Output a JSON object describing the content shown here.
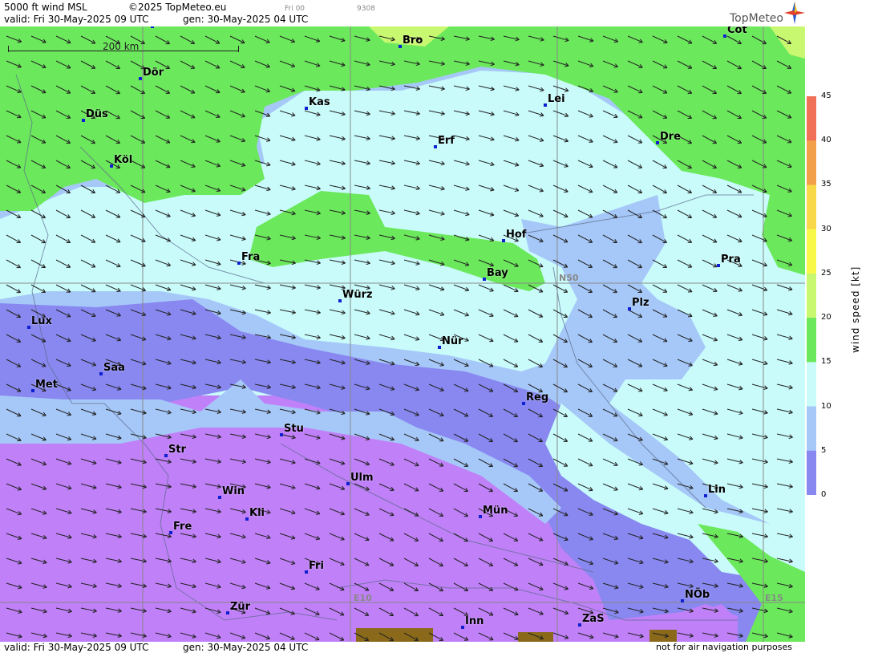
{
  "header": {
    "title": "5000 ft wind MSL",
    "copyright": "©2025 TopMeteo.eu",
    "run_small": "Fri 00",
    "code_small": "9308",
    "valid": "valid:  Fri  30-May-2025  09 UTC",
    "gen": "gen: 30-May-2025 04 UTC",
    "logo": "TopMeteo"
  },
  "footer": {
    "valid": "valid:  Fri  30-May-2025  09 UTC",
    "gen": "gen: 30-May-2025 04 UTC",
    "disclaimer": "not for air navigation purposes"
  },
  "scale_bar": {
    "label": "200 km"
  },
  "grid_labels": {
    "lat": "N50",
    "lon1": "E10",
    "lon2": "E15"
  },
  "legend": {
    "title": "wind speed [kt]",
    "ticks": [
      "45",
      "40",
      "35",
      "30",
      "25",
      "20",
      "15",
      "10",
      "5",
      "0"
    ],
    "colors": [
      "#f07058",
      "#f3a04a",
      "#f8d848",
      "#f8f848",
      "#c8f870",
      "#6ce85c",
      "#c9fbfb",
      "#a6c8f8",
      "#8888f0",
      "#c080f8"
    ]
  },
  "cities": [
    {
      "name": "Mün",
      "id": "mun-top"
    },
    {
      "name": "Bro",
      "id": "bro"
    },
    {
      "name": "Cot",
      "id": "cot"
    },
    {
      "name": "Dör",
      "id": "dor"
    },
    {
      "name": "Kas",
      "id": "kas"
    },
    {
      "name": "Lei",
      "id": "lei"
    },
    {
      "name": "Düs",
      "id": "dus"
    },
    {
      "name": "Erf",
      "id": "erf"
    },
    {
      "name": "Dre",
      "id": "dre"
    },
    {
      "name": "Köl",
      "id": "kol"
    },
    {
      "name": "Hof",
      "id": "hof"
    },
    {
      "name": "Fra",
      "id": "fra"
    },
    {
      "name": "Pra",
      "id": "pra"
    },
    {
      "name": "Bay",
      "id": "bay"
    },
    {
      "name": "Würz",
      "id": "wur"
    },
    {
      "name": "Plz",
      "id": "plz"
    },
    {
      "name": "Lux",
      "id": "lux"
    },
    {
      "name": "Nür",
      "id": "nur"
    },
    {
      "name": "Saa",
      "id": "saa"
    },
    {
      "name": "Met",
      "id": "met"
    },
    {
      "name": "Reg",
      "id": "reg"
    },
    {
      "name": "Stu",
      "id": "stu"
    },
    {
      "name": "Str",
      "id": "str"
    },
    {
      "name": "Ulm",
      "id": "ulm"
    },
    {
      "name": "Win",
      "id": "win"
    },
    {
      "name": "Lin",
      "id": "lin"
    },
    {
      "name": "Kli",
      "id": "kli"
    },
    {
      "name": "Mün",
      "id": "mun"
    },
    {
      "name": "Fre",
      "id": "fre"
    },
    {
      "name": "Fri",
      "id": "fri"
    },
    {
      "name": "NÖb",
      "id": "nob"
    },
    {
      "name": "Zür",
      "id": "zur"
    },
    {
      "name": "ZaS",
      "id": "zas"
    },
    {
      "name": "Inn",
      "id": "inn"
    }
  ]
}
